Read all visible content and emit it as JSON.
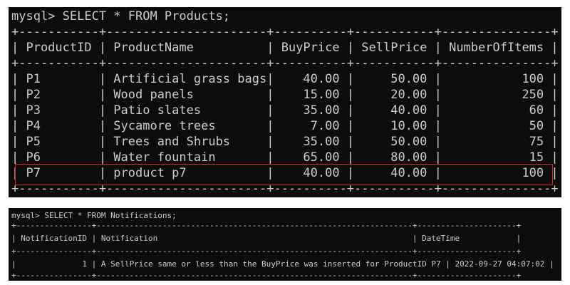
{
  "highlight_color": "#e0261b",
  "terminal_background": "#0c0c0c",
  "terminal_text_color": "#cccccc",
  "query1": {
    "command": "mysql> SELECT * FROM Products;",
    "border": "+-----------+----------------------+----------+-----------+---------------+",
    "header": "| ProductID | ProductName          | BuyPrice | SellPrice | NumberOfItems |",
    "rows": [
      "| P1        | Artificial grass bags|    40.00 |     50.00 |           100 |",
      "| P2        | Wood panels          |    15.00 |     20.00 |           250 |",
      "| P3        | Patio slates         |    35.00 |     40.00 |            60 |",
      "| P4        | Sycamore trees       |     7.00 |     10.00 |            50 |",
      "| P5        | Trees and Shrubs     |    35.00 |     50.00 |            75 |",
      "| P6        | Water fountain       |    65.00 |     80.00 |            15 |",
      "| P7        | product p7           |    40.00 |     40.00 |           100 |"
    ]
  },
  "query2": {
    "command": "mysql> SELECT * FROM Notifications;",
    "border": "+----------------+-------------------------------------------------------------------+---------------------+",
    "header": "| NotificationID | Notification                                                      | DateTime            |",
    "row": "|              1 | A SellPrice same or less than the BuyPrice was inserted for ProductID P7 | 2022-09-27 04:07:02 |"
  }
}
